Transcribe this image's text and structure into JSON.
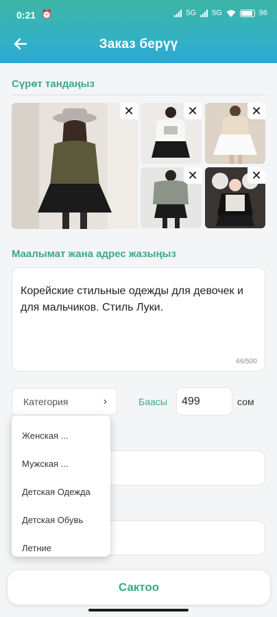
{
  "status_bar": {
    "time": "0:21",
    "network_1": "5G",
    "network_2": "5G",
    "battery": "96"
  },
  "header": {
    "title": "Заказ берүү",
    "back_icon": "arrow-left-icon"
  },
  "photos_section": {
    "label": "Сүрөт тандаңыз",
    "remove_symbol": "✕",
    "photos": [
      {
        "name": "photo-1",
        "desc": "girl in olive sweater and black pleated skirt"
      },
      {
        "name": "photo-2",
        "desc": "white printed top with black skirt"
      },
      {
        "name": "photo-3",
        "desc": "beige top with white skirt"
      },
      {
        "name": "photo-4",
        "desc": "grey sweatshirt with black skirt"
      },
      {
        "name": "photo-5",
        "desc": "black outfit with plush toys"
      }
    ]
  },
  "details_section": {
    "label": "Маалымат жана адрес жазыңыз",
    "description": "Корейские стильные одежды для девочек и для мальчиков. Стиль Луки.",
    "char_count": "66/500"
  },
  "category": {
    "label": "Категория",
    "chevron": "›"
  },
  "price": {
    "label": "Баасы",
    "value": "499",
    "unit": "сом"
  },
  "category_dropdown": {
    "options": [
      "Женская ...",
      "Мужская ...",
      "Детская Одежда",
      "Детская Обувь",
      "Летние"
    ]
  },
  "submit": {
    "label": "Сактоо"
  },
  "colors": {
    "accent": "#3aa98b",
    "header_gradient_start": "#3cb5a6",
    "header_gradient_end": "#2aa9d6"
  }
}
